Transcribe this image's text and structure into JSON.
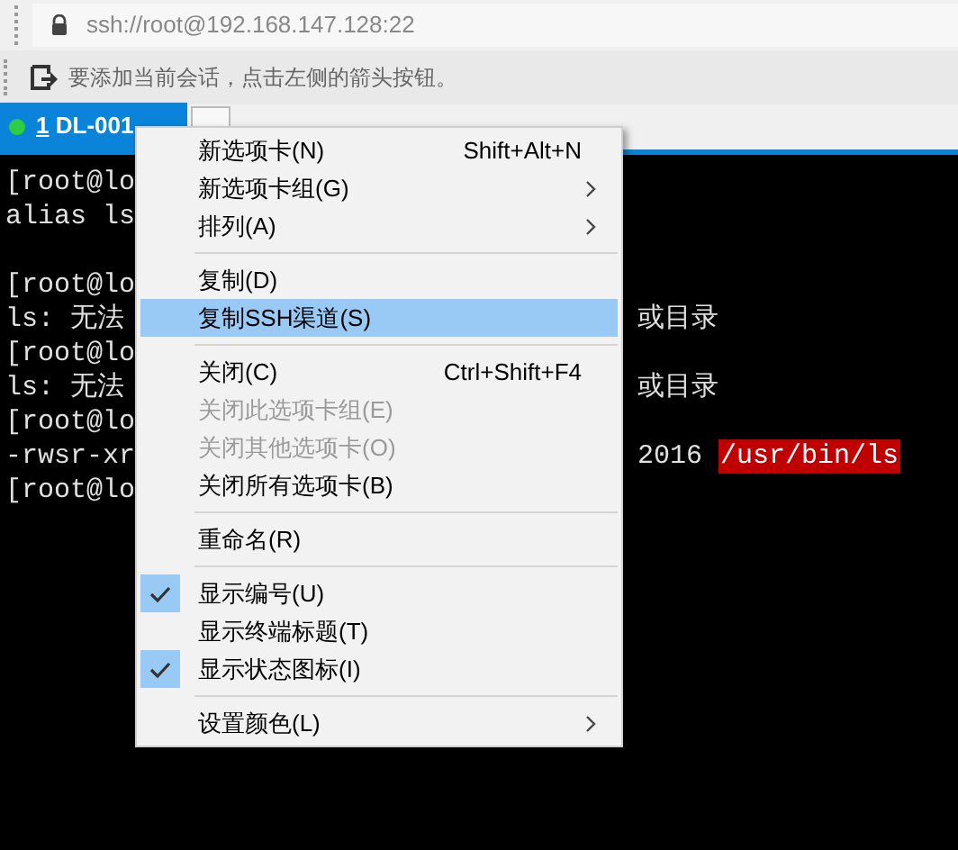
{
  "address_bar": {
    "url": "ssh://root@192.168.147.128:22"
  },
  "hint_bar": {
    "text": "要添加当前会话，点击左侧的箭头按钮。"
  },
  "tabs": [
    {
      "number": "1",
      "label": "DL-001",
      "selected": true
    }
  ],
  "terminal": {
    "lines": [
      {
        "kind": "text",
        "left": "[root@lo"
      },
      {
        "kind": "text",
        "left": "alias ls"
      },
      {
        "kind": "blank"
      },
      {
        "kind": "text",
        "left": "[root@lo"
      },
      {
        "kind": "text",
        "left": "ls: 无法",
        "right": [
          {
            "text": "或目录",
            "highlighted": false
          }
        ]
      },
      {
        "kind": "text",
        "left": "[root@lo"
      },
      {
        "kind": "text",
        "left": "ls: 无法",
        "right": [
          {
            "text": "或目录",
            "highlighted": false
          }
        ]
      },
      {
        "kind": "text",
        "left": "[root@lo"
      },
      {
        "kind": "text",
        "left": "-rwsr-xr",
        "right": [
          {
            "text": "2016",
            "highlighted": false
          },
          {
            "text": "/usr/bin/ls",
            "highlighted": true
          }
        ]
      },
      {
        "kind": "text",
        "left": "[root@lo"
      }
    ]
  },
  "context_menu": {
    "items": [
      {
        "kind": "item",
        "label": "新选项卡(N)",
        "shortcut": "Shift+Alt+N",
        "submenu": false,
        "disabled": false,
        "checked": false,
        "selected": false
      },
      {
        "kind": "item",
        "label": "新选项卡组(G)",
        "submenu": true,
        "disabled": false,
        "checked": false,
        "selected": false
      },
      {
        "kind": "item",
        "label": "排列(A)",
        "submenu": true,
        "disabled": false,
        "checked": false,
        "selected": false
      },
      {
        "kind": "separator"
      },
      {
        "kind": "item",
        "label": "复制(D)",
        "submenu": false,
        "disabled": false,
        "checked": false,
        "selected": false
      },
      {
        "kind": "item",
        "label": "复制SSH渠道(S)",
        "submenu": false,
        "disabled": false,
        "checked": false,
        "selected": true
      },
      {
        "kind": "separator"
      },
      {
        "kind": "item",
        "label": "关闭(C)",
        "shortcut": "Ctrl+Shift+F4",
        "submenu": false,
        "disabled": false,
        "checked": false,
        "selected": false
      },
      {
        "kind": "item",
        "label": "关闭此选项卡组(E)",
        "submenu": false,
        "disabled": true,
        "checked": false,
        "selected": false
      },
      {
        "kind": "item",
        "label": "关闭其他选项卡(O)",
        "submenu": false,
        "disabled": true,
        "checked": false,
        "selected": false
      },
      {
        "kind": "item",
        "label": "关闭所有选项卡(B)",
        "submenu": false,
        "disabled": false,
        "checked": false,
        "selected": false
      },
      {
        "kind": "separator"
      },
      {
        "kind": "item",
        "label": "重命名(R)",
        "submenu": false,
        "disabled": false,
        "checked": false,
        "selected": false
      },
      {
        "kind": "separator"
      },
      {
        "kind": "item",
        "label": "显示编号(U)",
        "submenu": false,
        "disabled": false,
        "checked": true,
        "selected": false
      },
      {
        "kind": "item",
        "label": "显示终端标题(T)",
        "submenu": false,
        "disabled": false,
        "checked": false,
        "selected": false
      },
      {
        "kind": "item",
        "label": "显示状态图标(I)",
        "submenu": false,
        "disabled": false,
        "checked": true,
        "selected": false
      },
      {
        "kind": "separator"
      },
      {
        "kind": "item",
        "label": "设置颜色(L)",
        "submenu": true,
        "disabled": false,
        "checked": false,
        "selected": false
      }
    ]
  }
}
